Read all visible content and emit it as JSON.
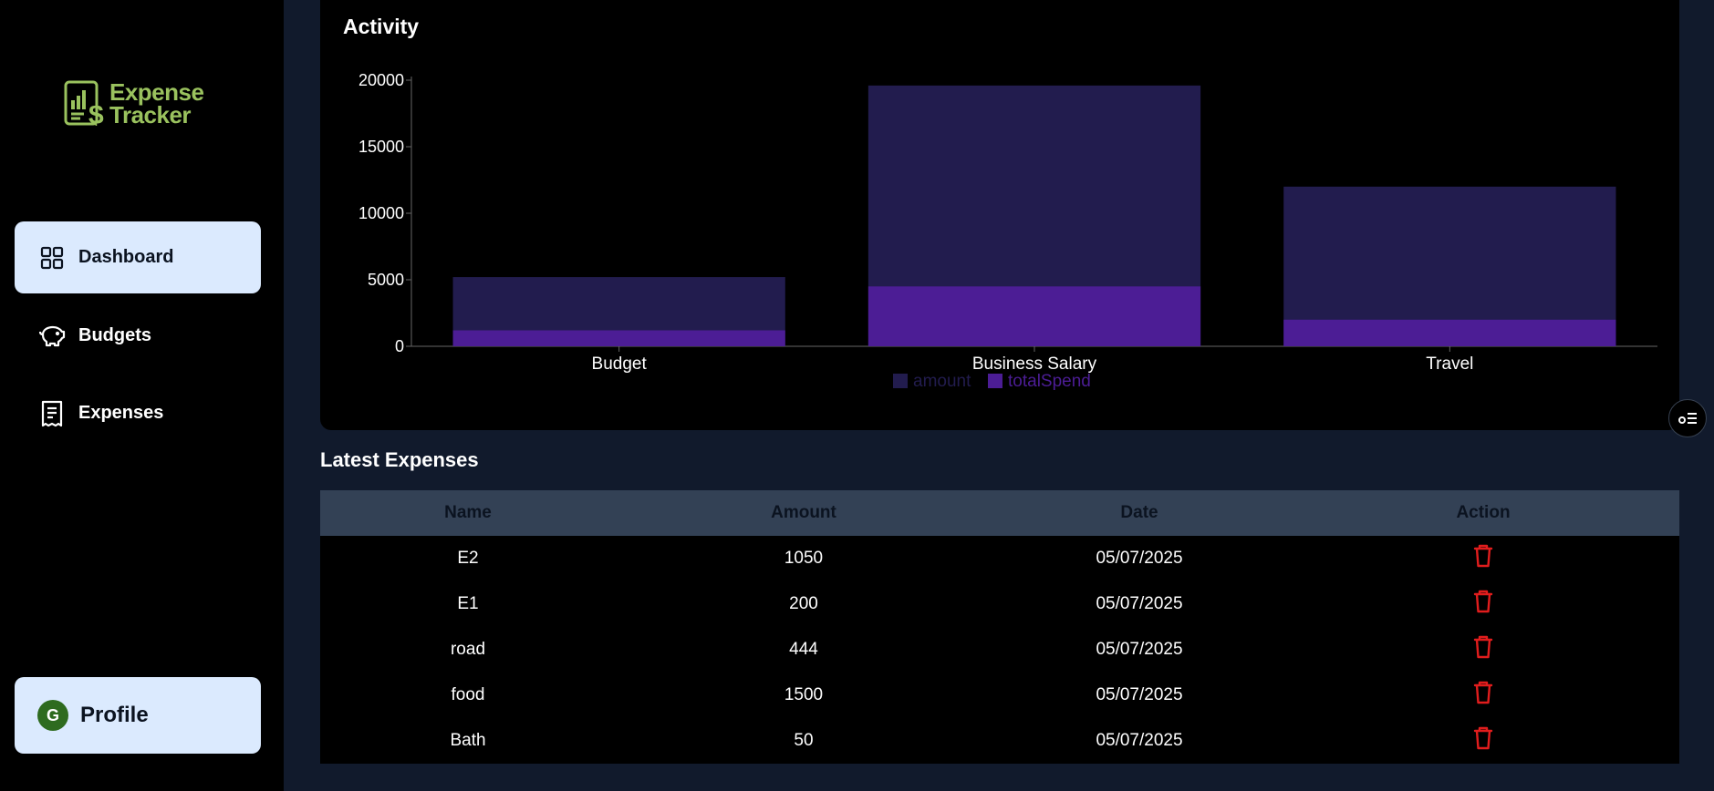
{
  "app": {
    "logo_line1": "Expense",
    "logo_line2": "Tracker"
  },
  "sidebar": {
    "items": [
      {
        "label": "Dashboard",
        "icon": "dashboard-grid-icon",
        "active": true
      },
      {
        "label": "Budgets",
        "icon": "piggy-bank-icon",
        "active": false
      },
      {
        "label": "Expenses",
        "icon": "receipt-icon",
        "active": false
      }
    ],
    "profile": {
      "label": "Profile",
      "initial": "G"
    }
  },
  "chart_section": {
    "title": "Activity"
  },
  "chart_data": {
    "type": "bar",
    "title": "Activity",
    "xlabel": "",
    "ylabel": "",
    "ylim": [
      0,
      20000
    ],
    "yticks": [
      0,
      5000,
      10000,
      15000,
      20000
    ],
    "categories": [
      "Budget",
      "Business Salary",
      "Travel"
    ],
    "series": [
      {
        "name": "amount",
        "values": [
          5200,
          19600,
          12000
        ],
        "color": "#221c4e"
      },
      {
        "name": "totalSpend",
        "values": [
          1200,
          4500,
          2000
        ],
        "color": "#4c1d95"
      }
    ],
    "legend_position": "bottom-center",
    "grid": false
  },
  "latest_expenses": {
    "title": "Latest Expenses",
    "columns": [
      "Name",
      "Amount",
      "Date",
      "Action"
    ],
    "rows": [
      {
        "name": "E2",
        "amount": "1050",
        "date": "05/07/2025"
      },
      {
        "name": "E1",
        "amount": "200",
        "date": "05/07/2025"
      },
      {
        "name": "road",
        "amount": "444",
        "date": "05/07/2025"
      },
      {
        "name": "food",
        "amount": "1500",
        "date": "05/07/2025"
      },
      {
        "name": "Bath",
        "amount": "50",
        "date": "05/07/2025"
      }
    ],
    "action_icon": "trash-icon",
    "action_color": "#e11d1d"
  }
}
